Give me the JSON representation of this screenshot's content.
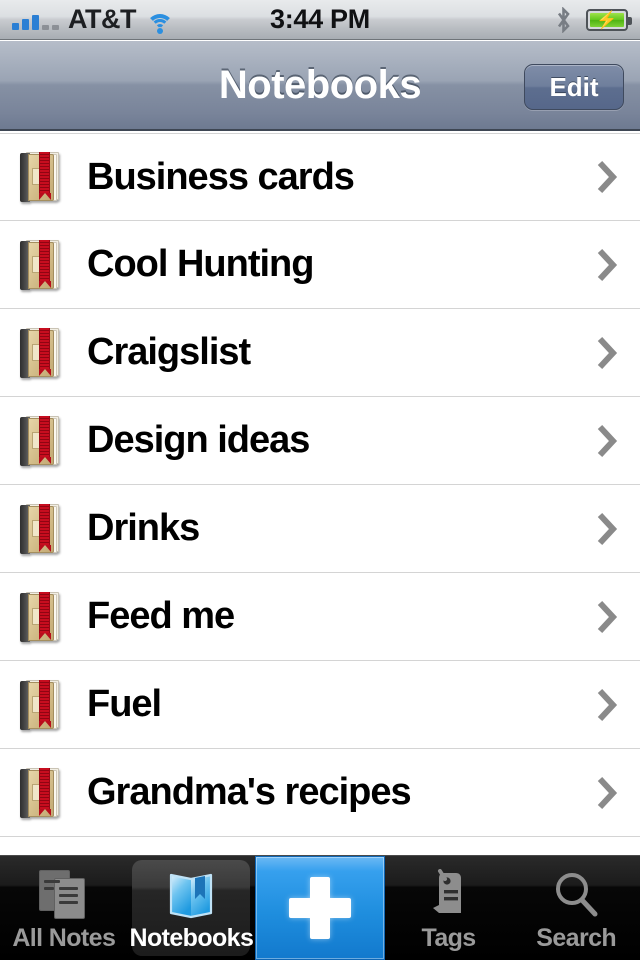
{
  "status_bar": {
    "carrier": "AT&T",
    "time": "3:44 PM",
    "signal_bars_filled": 3,
    "signal_bars_total": 5,
    "wifi_icon": "wifi-icon",
    "bluetooth_icon": "bluetooth-icon",
    "battery_icon": "battery-charging-icon",
    "battery_bolt": "⚡",
    "battery_color": "#63c81e"
  },
  "nav": {
    "title": "Notebooks",
    "edit_label": "Edit"
  },
  "list": {
    "rows": [
      {
        "label": "Business cards",
        "icon": "notebook-icon",
        "disclosure": "chevron-right-icon"
      },
      {
        "label": "Cool Hunting",
        "icon": "notebook-icon",
        "disclosure": "chevron-right-icon"
      },
      {
        "label": "Craigslist",
        "icon": "notebook-icon",
        "disclosure": "chevron-right-icon"
      },
      {
        "label": "Design ideas",
        "icon": "notebook-icon",
        "disclosure": "chevron-right-icon"
      },
      {
        "label": "Drinks",
        "icon": "notebook-icon",
        "disclosure": "chevron-right-icon"
      },
      {
        "label": "Feed me",
        "icon": "notebook-icon",
        "disclosure": "chevron-right-icon"
      },
      {
        "label": "Fuel",
        "icon": "notebook-icon",
        "disclosure": "chevron-right-icon"
      },
      {
        "label": "Grandma's recipes",
        "icon": "notebook-icon",
        "disclosure": "chevron-right-icon"
      }
    ]
  },
  "tabbar": {
    "accent_color": "#1f8ede",
    "tabs": [
      {
        "label": "All Notes",
        "icon": "notes-stack-icon",
        "active": false
      },
      {
        "label": "Notebooks",
        "icon": "book-icon",
        "active": true
      },
      {
        "label": "Tags",
        "icon": "tag-icon",
        "active": false
      },
      {
        "label": "Search",
        "icon": "search-icon",
        "active": false
      }
    ],
    "add_button": {
      "icon": "plus-icon",
      "label": "+"
    }
  }
}
